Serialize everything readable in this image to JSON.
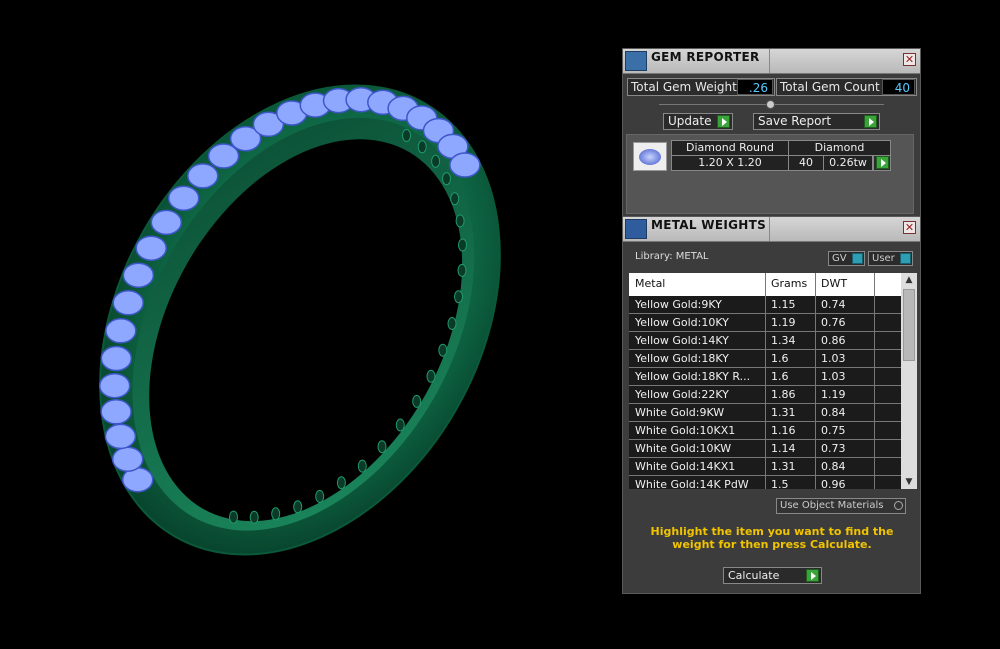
{
  "gem_reporter": {
    "title": "GEM REPORTER",
    "total_weight_label": "Total Gem Weight",
    "total_weight_value": ".26",
    "total_count_label": "Total Gem Count",
    "total_count_value": "40",
    "update_label": "Update",
    "save_report_label": "Save Report",
    "gem": {
      "shape": "Diamond Round",
      "size": "1.20 X 1.20",
      "material": "Diamond",
      "count": "40",
      "weight": "0.26tw"
    }
  },
  "metal_weights": {
    "title": "METAL WEIGHTS",
    "library": "Library: METAL",
    "gv_label": "GV",
    "user_label": "User",
    "columns": [
      "Metal",
      "Grams",
      "DWT"
    ],
    "rows": [
      {
        "metal": "Yellow Gold:9KY",
        "grams": "1.15",
        "dwt": "0.74"
      },
      {
        "metal": "Yellow Gold:10KY",
        "grams": "1.19",
        "dwt": "0.76"
      },
      {
        "metal": "Yellow Gold:14KY",
        "grams": "1.34",
        "dwt": "0.86"
      },
      {
        "metal": "Yellow Gold:18KY",
        "grams": "1.6",
        "dwt": "1.03"
      },
      {
        "metal": "Yellow Gold:18KY R...",
        "grams": "1.6",
        "dwt": "1.03"
      },
      {
        "metal": "Yellow Gold:22KY",
        "grams": "1.86",
        "dwt": "1.19"
      },
      {
        "metal": "White Gold:9KW",
        "grams": "1.31",
        "dwt": "0.84"
      },
      {
        "metal": "White Gold:10KX1",
        "grams": "1.16",
        "dwt": "0.75"
      },
      {
        "metal": "White Gold:10KW",
        "grams": "1.14",
        "dwt": "0.73"
      },
      {
        "metal": "White Gold:14KX1",
        "grams": "1.31",
        "dwt": "0.84"
      },
      {
        "metal": "White Gold:14K PdW",
        "grams": "1.5",
        "dwt": "0.96"
      }
    ],
    "use_object_materials_label": "Use Object Materials",
    "instruction": "Highlight the item you want to find the weight for then press Calculate.",
    "calculate_label": "Calculate"
  },
  "colors": {
    "ring_green": "#0f6e4a",
    "gem_blue": "#8fa8ff",
    "instruction_yellow": "#f2c400",
    "value_cyan": "#5bc9ff"
  }
}
